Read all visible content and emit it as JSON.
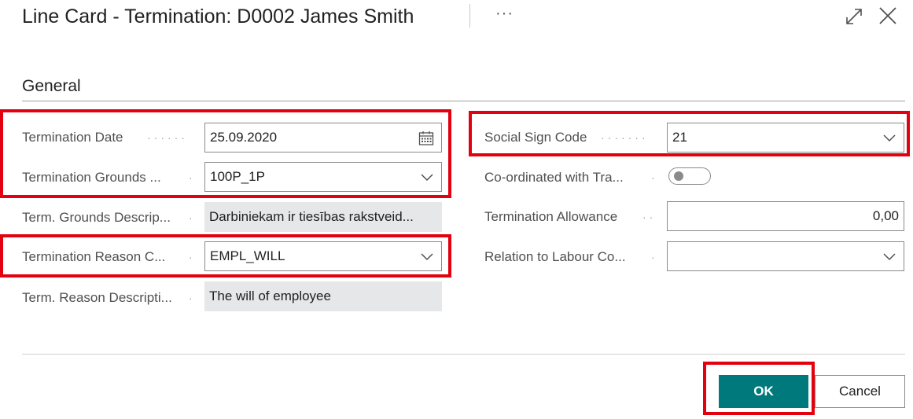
{
  "dialog": {
    "title": "Line Card - Termination: D0002 James Smith",
    "more_label": "···"
  },
  "section": {
    "title": "General"
  },
  "left_fields": {
    "termination_date": {
      "label": "Termination Date",
      "value": "25.09.2020"
    },
    "termination_grounds": {
      "label": "Termination Grounds ...",
      "value": "100P_1P"
    },
    "term_grounds_description": {
      "label": "Term. Grounds Descrip...",
      "value": "Darbiniekam ir tiesības rakstveid..."
    },
    "termination_reason_code": {
      "label": "Termination Reason C...",
      "value": "EMPL_WILL"
    },
    "term_reason_description": {
      "label": "Term. Reason Descripti...",
      "value": "The will of employee"
    }
  },
  "right_fields": {
    "social_sign_code": {
      "label": "Social Sign Code",
      "value": "21"
    },
    "coordinated_with_trade_union": {
      "label": "Co-ordinated with Tra...",
      "value": false
    },
    "termination_allowance": {
      "label": "Termination Allowance",
      "value": "0,00"
    },
    "relation_to_labour_code": {
      "label": "Relation to Labour Co...",
      "value": ""
    }
  },
  "footer": {
    "ok_label": "OK",
    "cancel_label": "Cancel"
  },
  "colors": {
    "accent": "#00797c",
    "highlight": "#e3000f"
  },
  "icons": [
    "expand-icon",
    "close-icon",
    "calendar-icon",
    "chevron-down-icon"
  ]
}
